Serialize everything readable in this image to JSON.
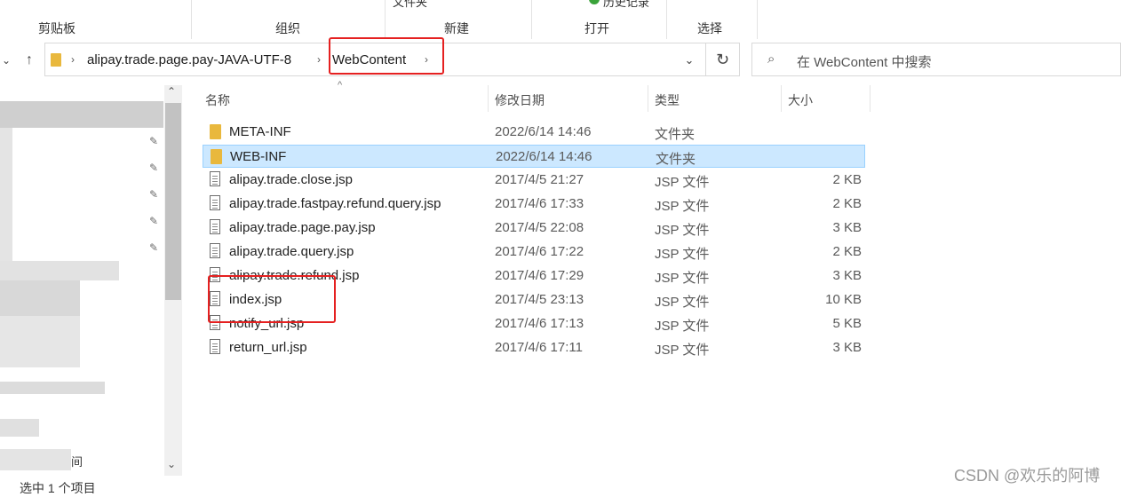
{
  "ribbon": {
    "groups": [
      {
        "label": "剪贴板"
      },
      {
        "label": "组织"
      },
      {
        "label": "新建",
        "top_label": "文件夹"
      },
      {
        "label": "打开",
        "top_label": "历史记录"
      },
      {
        "label": "选择"
      }
    ]
  },
  "address": {
    "crumbs": [
      "alipay.trade.page.pay-JAVA-UTF-8",
      "WebContent"
    ]
  },
  "search": {
    "placeholder": "在 WebContent 中搜索"
  },
  "columns": {
    "name": "名称",
    "date": "修改日期",
    "type": "类型",
    "size": "大小"
  },
  "files": [
    {
      "name": "META-INF",
      "date": "2022/6/14 14:46",
      "type": "文件夹",
      "size": "",
      "kind": "folder"
    },
    {
      "name": "WEB-INF",
      "date": "2022/6/14 14:46",
      "type": "文件夹",
      "size": "",
      "kind": "folder",
      "selected": true
    },
    {
      "name": "alipay.trade.close.jsp",
      "date": "2017/4/5 21:27",
      "type": "JSP 文件",
      "size": "2 KB",
      "kind": "file"
    },
    {
      "name": "alipay.trade.fastpay.refund.query.jsp",
      "date": "2017/4/6 17:33",
      "type": "JSP 文件",
      "size": "2 KB",
      "kind": "file"
    },
    {
      "name": "alipay.trade.page.pay.jsp",
      "date": "2017/4/5 22:08",
      "type": "JSP 文件",
      "size": "3 KB",
      "kind": "file"
    },
    {
      "name": "alipay.trade.query.jsp",
      "date": "2017/4/6 17:22",
      "type": "JSP 文件",
      "size": "2 KB",
      "kind": "file"
    },
    {
      "name": "alipay.trade.refund.jsp",
      "date": "2017/4/6 17:29",
      "type": "JSP 文件",
      "size": "3 KB",
      "kind": "file"
    },
    {
      "name": "index.jsp",
      "date": "2017/4/5 23:13",
      "type": "JSP 文件",
      "size": "10 KB",
      "kind": "file"
    },
    {
      "name": "notify_url.jsp",
      "date": "2017/4/6 17:13",
      "type": "JSP 文件",
      "size": "5 KB",
      "kind": "file"
    },
    {
      "name": "return_url.jsp",
      "date": "2017/4/6 17:11",
      "type": "JSP 文件",
      "size": "3 KB",
      "kind": "file"
    }
  ],
  "sidebar": {
    "partial_text": "间"
  },
  "status": {
    "text": "选中 1 个项目"
  },
  "watermark": {
    "text": "CSDN @欢乐的阿博"
  },
  "icons": {
    "back": "up-arrow-icon",
    "search": "search-icon",
    "refresh": "refresh-icon",
    "pin": "pin-icon"
  },
  "colors": {
    "highlight": "#e52020",
    "selection": "#cce8ff",
    "folder": "#e9b83d"
  }
}
